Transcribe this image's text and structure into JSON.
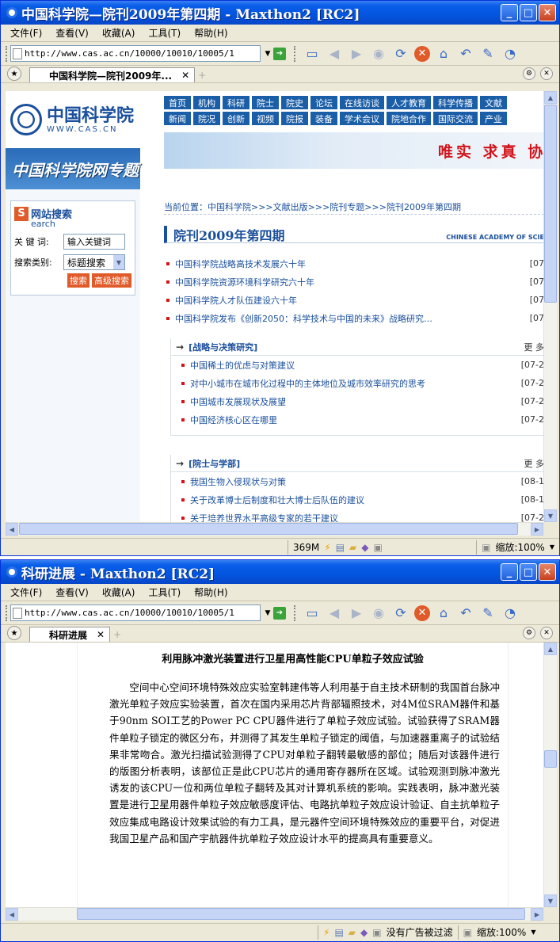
{
  "window1": {
    "title": "中国科学院—院刊2009年第四期 - Maxthon2 [RC2]",
    "menu": [
      "文件(F)",
      "查看(V)",
      "收藏(A)",
      "工具(T)",
      "帮助(H)"
    ],
    "address": "http://www.cas.ac.cn/10000/10010/10005/1",
    "tab_label": "中国科学院—院刊2009年...",
    "status": {
      "memory": "369M",
      "zoom": "缩放:100%"
    },
    "page": {
      "logo_cn": "中国科学院",
      "logo_en": "WWW.CAS.CN",
      "nav_row1": [
        "首页",
        "机构",
        "科研",
        "院士",
        "院史",
        "论坛",
        "在线访谈",
        "人才教育",
        "科学传播",
        "文献"
      ],
      "nav_row2": [
        "新闻",
        "院况",
        "创新",
        "视频",
        "院报",
        "装备",
        "学术会议",
        "院地合作",
        "国际交流",
        "产业"
      ],
      "banner_text": "唯实 求真 协力",
      "sidebar_title": "中国科学院网专题",
      "search": {
        "title": "网站搜索",
        "subtitle": "earch",
        "badge": "S",
        "keyword_label": "关 键 词:",
        "keyword_value": "输入关键词",
        "category_label": "搜索类别:",
        "category_value": "标题搜索",
        "btn_search": "搜索",
        "btn_advanced": "高级搜索"
      },
      "breadcrumb": "当前位置：中国科学院>>>文献出版>>>院刊专题>>>院刊2009年第四期",
      "section_title": "院刊2009年第四期",
      "section_en": "CHINESE ACADEMY OF SCIE",
      "top_items": [
        {
          "text": "中国科学院战略高技术发展六十年",
          "date": "[07"
        },
        {
          "text": "中国科学院资源环境科学研究六十年",
          "date": "[07"
        },
        {
          "text": "中国科学院人才队伍建设六十年",
          "date": "[07"
        },
        {
          "text": "中国科学院发布《创新2050：科学技术与中国的未来》战略研究…",
          "date": "[07"
        }
      ],
      "box1": {
        "title": "[战略与决策研究]",
        "more": "更 多",
        "items": [
          {
            "text": "中国稀土的优虑与对策建议",
            "date": "[07-2"
          },
          {
            "text": "对中小城市在城市化过程中的主体地位及城市效率研究的思考",
            "date": "[07-2"
          },
          {
            "text": "中国城市发展现状及展望",
            "date": "[07-2"
          },
          {
            "text": "中国经济核心区在哪里",
            "date": "[07-2"
          }
        ]
      },
      "box2": {
        "title": "[院士与学部]",
        "more": "更 多",
        "items": [
          {
            "text": "我国生物入侵现状与对策",
            "date": "[08-1"
          },
          {
            "text": "关于改革博士后制度和壮大博士后队伍的建议",
            "date": "[08-1"
          },
          {
            "text": "关于培养世界水平高级专家的若干建议",
            "date": "[07-2"
          }
        ]
      }
    }
  },
  "window2": {
    "title": "科研进展 - Maxthon2 [RC2]",
    "menu": [
      "文件(F)",
      "查看(V)",
      "收藏(A)",
      "工具(T)",
      "帮助(H)"
    ],
    "address": "http://www.cas.ac.cn/10000/10010/10005/1",
    "tab_label": "科研进展",
    "status": {
      "adblock": "没有广告被过滤",
      "zoom": "缩放:100%"
    },
    "article": {
      "title": "利用脉冲激光装置进行卫星用高性能CPU单粒子效应试验",
      "body": "空间中心空间环境特殊效应实验室韩建伟等人利用基于自主技术研制的我国首台脉冲激光单粒子效应实验装置，首次在国内采用芯片背部辐照技术，对4M位SRAM器件和基于90nm SOI工艺的Power PC CPU器件进行了单粒子效应试验。试验获得了SRAM器件单粒子锁定的微区分布，并测得了其发生单粒子锁定的阈值，与加速器重离子的试验结果非常吻合。激光扫描试验测得了CPU对单粒子翻转最敏感的部位；随后对该器件进行的版图分析表明，该部位正是此CPU芯片的通用寄存器所在区域。试验观测到脉冲激光诱发的该CPU一位和两位单粒子翻转及其对计算机系统的影响。实践表明，脉冲激光装置是进行卫星用器件单粒子效应敏感度评估、电路抗单粒子效应设计验证、自主抗单粒子效应集成电路设计效果试验的有力工具，是元器件空间环境特殊效应的重要平台，对促进我国卫星产品和国产宇航器件抗单粒子效应设计水平的提高具有重要意义。"
    }
  }
}
